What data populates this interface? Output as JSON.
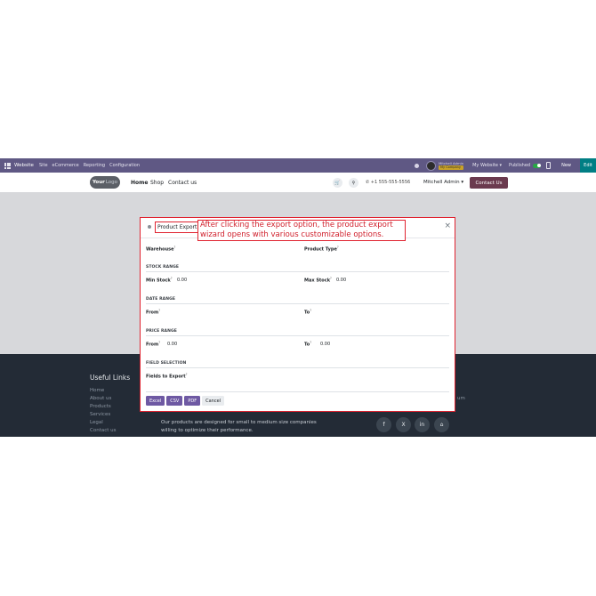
{
  "topbar": {
    "brand": "Website",
    "menu": [
      "Site",
      "eCommerce",
      "Reporting",
      "Configuration"
    ],
    "user_name": "Mitchell Admin",
    "db_badge": "My Company",
    "website_selector": "My Website",
    "published_label": "Published",
    "new_label": "New",
    "edit_label": "Edit"
  },
  "header": {
    "logo_main": "Your",
    "logo_sub": "Logo",
    "nav": [
      "Home",
      "Shop",
      "Contact us"
    ],
    "phone": "+1 555-555-5556",
    "user_menu": "Mitchell Admin",
    "contact_button": "Contact Us"
  },
  "footer": {
    "useful_links_title": "Useful Links",
    "links": [
      "Home",
      "About us",
      "Products",
      "Services",
      "Legal",
      "Contact us"
    ],
    "company_description": "Our products are designed for small to medium size companies willing to optimize their performance.",
    "partial_text": "um",
    "social": [
      "f",
      "X",
      "in",
      "⌂"
    ]
  },
  "dialog": {
    "title": "Product Export",
    "annotation": "After clicking the export option, the product export wizard opens with various customizable options.",
    "close": "×",
    "fields": {
      "warehouse": "Warehouse",
      "product_type": "Product Type",
      "min_stock": "Min Stock",
      "min_stock_value": "0.00",
      "max_stock": "Max Stock",
      "max_stock_value": "0.00",
      "date_from": "From",
      "date_to": "To",
      "price_from": "From",
      "price_from_value": "0.00",
      "price_to": "To",
      "price_to_value": "0.00",
      "fields_to_export": "Fields to Export"
    },
    "sections": {
      "stock_range": "STOCK RANGE",
      "date_range": "DATE RANGE",
      "price_range": "PRICE RANGE",
      "field_selection": "FIELD SELECTION"
    },
    "help_mark": "?",
    "buttons": {
      "excel": "Excel",
      "csv": "CSV",
      "pdf": "PDF",
      "cancel": "Cancel"
    }
  },
  "colors": {
    "topbar": "#5f5884",
    "primary_button": "#6e59a3",
    "annotation_red": "#e0222f",
    "footer_bg": "#232b36",
    "contact_button": "#6b3a4e"
  }
}
